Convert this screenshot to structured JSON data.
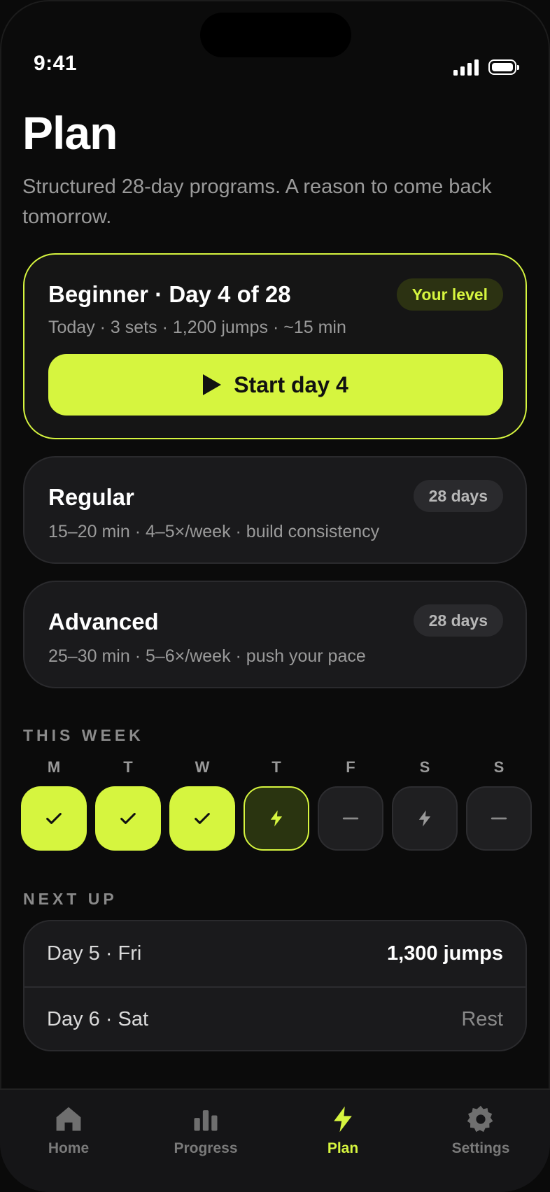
{
  "status": {
    "time": "9:41"
  },
  "header": {
    "title": "Plan",
    "subtitle": "Structured 28-day programs. A reason to come back tomorrow."
  },
  "programs": [
    {
      "title": "Beginner · Day 4 of 28",
      "subtitle": "Today · 3 sets · 1,200 jumps · ~15 min",
      "badge": "Your level",
      "button": "Start day 4"
    },
    {
      "title": "Regular",
      "subtitle": "15–20 min · 4–5×/week · build consistency",
      "badge": "28 days"
    },
    {
      "title": "Advanced",
      "subtitle": "25–30 min · 5–6×/week · push your pace",
      "badge": "28 days"
    }
  ],
  "week": {
    "heading": "THIS WEEK",
    "days": [
      {
        "letter": "M",
        "state": "done",
        "icon": "check-icon"
      },
      {
        "letter": "T",
        "state": "done",
        "icon": "check-icon"
      },
      {
        "letter": "W",
        "state": "done",
        "icon": "check-icon"
      },
      {
        "letter": "T",
        "state": "today",
        "icon": "bolt-icon"
      },
      {
        "letter": "F",
        "state": "rest",
        "icon": "dash-icon"
      },
      {
        "letter": "S",
        "state": "planned",
        "icon": "bolt-icon"
      },
      {
        "letter": "S",
        "state": "rest",
        "icon": "dash-icon"
      }
    ]
  },
  "next_up": {
    "heading": "NEXT UP",
    "items": [
      {
        "label": "Day 5 · Fri",
        "value": "1,300 jumps"
      },
      {
        "label": "Day 6 · Sat",
        "value": "Rest"
      }
    ]
  },
  "tabs": [
    {
      "label": "Home",
      "icon": "home-icon"
    },
    {
      "label": "Progress",
      "icon": "bar-chart-icon"
    },
    {
      "label": "Plan",
      "icon": "bolt-icon",
      "active": true
    },
    {
      "label": "Settings",
      "icon": "gear-icon"
    }
  ],
  "colors": {
    "accent": "#d6f53f",
    "background": "#0b0b0b",
    "card": "#1a1a1c",
    "muted": "#9a9a9a"
  }
}
